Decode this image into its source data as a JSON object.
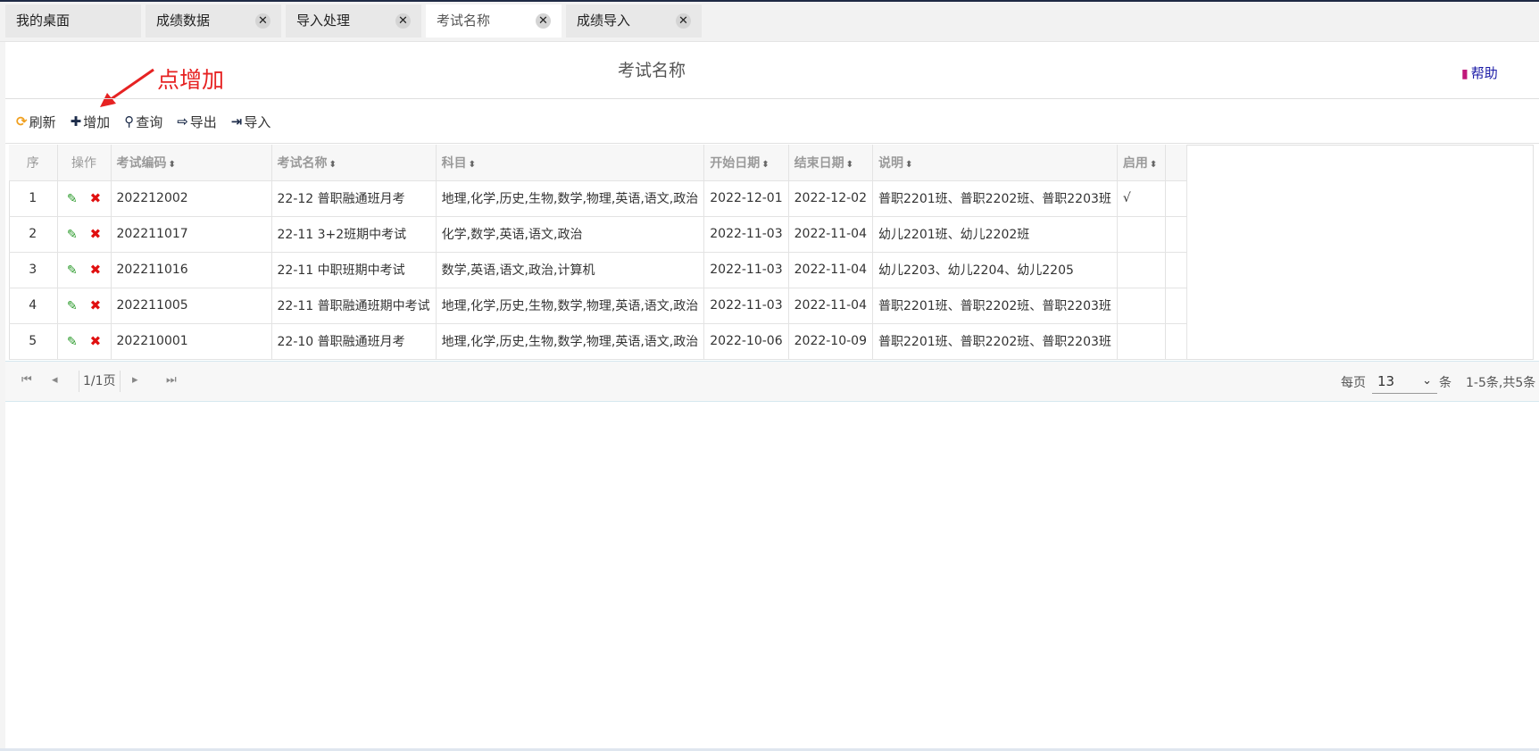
{
  "tabs": [
    {
      "label": "我的桌面",
      "closable": false,
      "active": false
    },
    {
      "label": "成绩数据",
      "closable": true,
      "active": false
    },
    {
      "label": "导入处理",
      "closable": true,
      "active": false
    },
    {
      "label": "考试名称",
      "closable": true,
      "active": true
    },
    {
      "label": "成绩导入",
      "closable": true,
      "active": false
    }
  ],
  "close_glyph": "✕",
  "page": {
    "title": "考试名称",
    "help_label": "帮助",
    "annotation": "点增加"
  },
  "toolbar": {
    "refresh": "刷新",
    "add": "增加",
    "query": "查询",
    "export": "导出",
    "import": "导入"
  },
  "table": {
    "headers": {
      "seq": "序",
      "ops": "操作",
      "code": "考试编码",
      "name": "考试名称",
      "subjects": "科目",
      "start": "开始日期",
      "end": "结束日期",
      "desc": "说明",
      "enabled": "启用"
    },
    "rows": [
      {
        "seq": "1",
        "code": "202212002",
        "name": "22-12 普职融通班月考",
        "subjects": "地理,化学,历史,生物,数学,物理,英语,语文,政治",
        "start": "2022-12-01",
        "end": "2022-12-02",
        "desc": "普职2201班、普职2202班、普职2203班",
        "enabled": "√"
      },
      {
        "seq": "2",
        "code": "202211017",
        "name": "22-11 3+2班期中考试",
        "subjects": "化学,数学,英语,语文,政治",
        "start": "2022-11-03",
        "end": "2022-11-04",
        "desc": "幼儿2201班、幼儿2202班",
        "enabled": ""
      },
      {
        "seq": "3",
        "code": "202211016",
        "name": "22-11 中职班期中考试",
        "subjects": "数学,英语,语文,政治,计算机",
        "start": "2022-11-03",
        "end": "2022-11-04",
        "desc": "幼儿2203、幼儿2204、幼儿2205",
        "enabled": ""
      },
      {
        "seq": "4",
        "code": "202211005",
        "name": "22-11 普职融通班期中考试",
        "subjects": "地理,化学,历史,生物,数学,物理,英语,语文,政治",
        "start": "2022-11-03",
        "end": "2022-11-04",
        "desc": "普职2201班、普职2202班、普职2203班",
        "enabled": ""
      },
      {
        "seq": "5",
        "code": "202210001",
        "name": "22-10 普职融通班月考",
        "subjects": "地理,化学,历史,生物,数学,物理,英语,语文,政治",
        "start": "2022-10-06",
        "end": "2022-10-09",
        "desc": "普职2201班、普职2202班、普职2203班",
        "enabled": ""
      }
    ]
  },
  "pager": {
    "page_info": "1/1页",
    "per_page_label": "每页",
    "per_page_value": "13",
    "per_page_unit": "条",
    "total": "1-5条,共5条"
  },
  "colors": {
    "annotation": "#e62222",
    "refresh_icon": "#f0a020",
    "edit_icon": "#2a9a2a",
    "delete_icon": "#e01010",
    "help_book": "#c0187a"
  },
  "icons": {
    "refresh": "refresh-icon",
    "add": "plus-icon",
    "query": "search-icon",
    "export": "export-icon",
    "import": "import-icon",
    "edit": "pencil-icon",
    "delete": "delete-x-icon",
    "help": "book-icon"
  }
}
